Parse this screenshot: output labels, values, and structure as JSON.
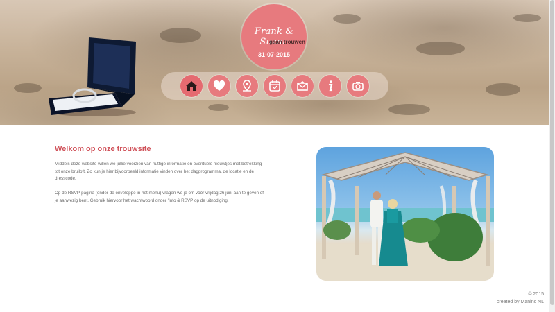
{
  "header": {
    "badge_names": "Frank & Suzan",
    "badge_subtitle": "gaan trouwen",
    "badge_date": "31-07-2015",
    "accent_color": "#e77a7e"
  },
  "nav": {
    "items": [
      {
        "icon": "home-icon",
        "active": true
      },
      {
        "icon": "heart-icon"
      },
      {
        "icon": "location-pin-icon"
      },
      {
        "icon": "calendar-icon"
      },
      {
        "icon": "envelope-icon"
      },
      {
        "icon": "info-icon"
      },
      {
        "icon": "camera-icon"
      }
    ]
  },
  "main": {
    "title": "Welkom op onze trouwsite",
    "paragraph1": "Middels deze website willen we jullie voorzien van nuttige informatie en eventuele nieuwtjes met betrekking tot onze bruiloft. Zo kun je hier bijvoorbeeld informatie vinden over het dagprogramma, de locatie en de dresscode.",
    "paragraph2": "Op de RSVP-pagina (onder de enveloppe in het menu) vragen we je om vóór vrijdag 26 juni aan te geven of je aanwezig bent. Gebruik hiervoor het wachtwoord onder 'Info & RSVP op de uitnodiging.",
    "title_color": "#d0525a"
  },
  "footer": {
    "copyright": "© 2015",
    "credit": "created by Maninc NL"
  }
}
